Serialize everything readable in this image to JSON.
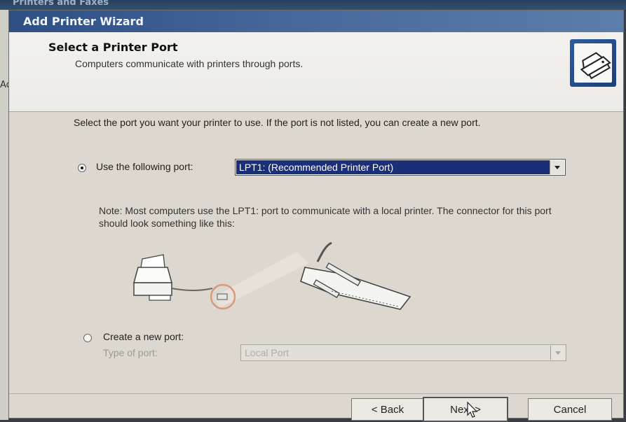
{
  "background_window": {
    "title": "Printers and Faxes",
    "left_fragment": "Ac"
  },
  "wizard": {
    "title": "Add Printer Wizard",
    "header": {
      "title": "Select a Printer Port",
      "subtitle": "Computers communicate with printers through ports.",
      "icon": "printer-icon"
    },
    "intro": "Select the port you want your printer to use.  If the port is not listed, you can create a new port.",
    "use_port": {
      "label": "Use the following port:",
      "selected": true,
      "value": "LPT1: (Recommended Printer Port)"
    },
    "note": "Note: Most computers use the LPT1: port to communicate with a local printer. The connector for this port should look something like this:",
    "create_port": {
      "label": "Create a new port:",
      "selected": false,
      "type_label": "Type of port:",
      "type_value": "Local Port"
    },
    "buttons": {
      "back": "< Back",
      "next": "Next >",
      "cancel": "Cancel"
    }
  },
  "colors": {
    "titlebar": "#2d4f84",
    "selection": "#1b2f77",
    "dialog": "#dcd8cf"
  }
}
